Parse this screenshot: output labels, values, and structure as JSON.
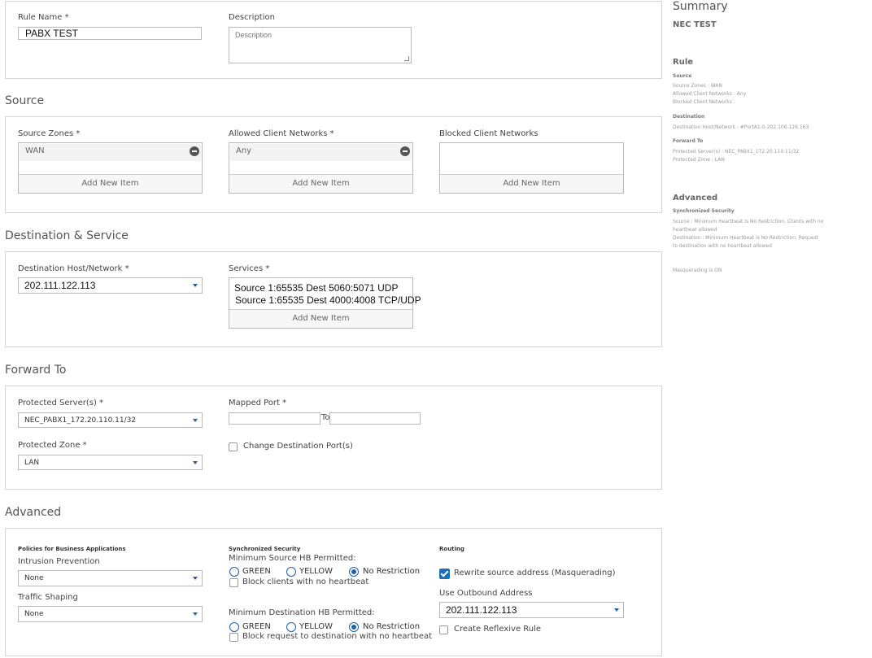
{
  "rule_panel": {
    "rule_name_label": "Rule Name *",
    "rule_name_value": "PABX TEST",
    "description_label": "Description",
    "description_placeholder": "Description"
  },
  "source": {
    "title": "Source",
    "zones_label": "Source Zones *",
    "zones_item": "WAN",
    "allowed_label": "Allowed Client Networks *",
    "allowed_item": "Any",
    "blocked_label": "Blocked Client Networks",
    "add_new": "Add New Item"
  },
  "destination": {
    "title": "Destination & Service",
    "host_label": "Destination Host/Network *",
    "host_value": "202.111.122.113",
    "services_label": "Services *",
    "services": [
      "Source 1:65535 Dest 5060:5071 UDP",
      "Source 1:65535 Dest 4000:4008 TCP/UDP"
    ],
    "add_new": "Add New Item"
  },
  "forward": {
    "title": "Forward To",
    "servers_label": "Protected Server(s) *",
    "servers_value": "NEC_PABX1_172.20.110.11/32",
    "mapped_port_label": "Mapped Port *",
    "to_label": "To",
    "zone_label": "Protected Zone *",
    "zone_value": "LAN",
    "change_port_label": "Change Destination Port(s)"
  },
  "advanced": {
    "title": "Advanced",
    "policies_heading": "Policies for Business Applications",
    "ips_label": "Intrusion Prevention",
    "ips_value": "None",
    "shaping_label": "Traffic Shaping",
    "shaping_value": "None",
    "sync_heading": "Synchronized Security",
    "min_source_label": "Minimum Source HB Permitted:",
    "min_dest_label": "Minimum Destination HB Permitted:",
    "radio_green": "GREEN",
    "radio_yellow": "YELLOW",
    "radio_none": "No Restriction",
    "block_clients_label": "Block clients with no heartbeat",
    "block_dest_label": "Block request to destination with no heartbeat",
    "routing_heading": "Routing",
    "rewrite_label": "Rewrite source address (Masquerading)",
    "outbound_label": "Use Outbound Address",
    "outbound_value": "202.111.122.113",
    "reflexive_label": "Create Reflexive Rule"
  },
  "summary": {
    "title": "Summary",
    "rule_name": "NEC TEST",
    "rule_heading": "Rule",
    "source_heading": "Source",
    "source_lines": [
      "Source Zones : WAN",
      "Allowed Client Networks : Any",
      "Blocked Client Networks :"
    ],
    "destination_heading": "Destination",
    "destination_line": "Destination Host/Network : #PortA1:0-202.106.126.163",
    "forward_heading": "Forward To",
    "forward_lines": [
      "Protected Server(s) : NEC_PABX1_172.20.110.11/32",
      "Protected Zone : LAN"
    ],
    "advanced_heading": "Advanced",
    "sync_heading": "Synchronized Security",
    "sync_source_lines": [
      "Source : Minimum Heartbeat is No Restriction, Clients with no",
      "heartbeat allowed"
    ],
    "sync_dest_lines": [
      "Destination : Minimum Heartbeat is No Restriction, Request",
      "to destination with no heartbeat allowed"
    ],
    "masquerading": "Masquerading is ON"
  },
  "colors": {
    "accent": "#1f5fa8",
    "checkbox": "#1d6fb8",
    "border": "#d4d4d4"
  }
}
